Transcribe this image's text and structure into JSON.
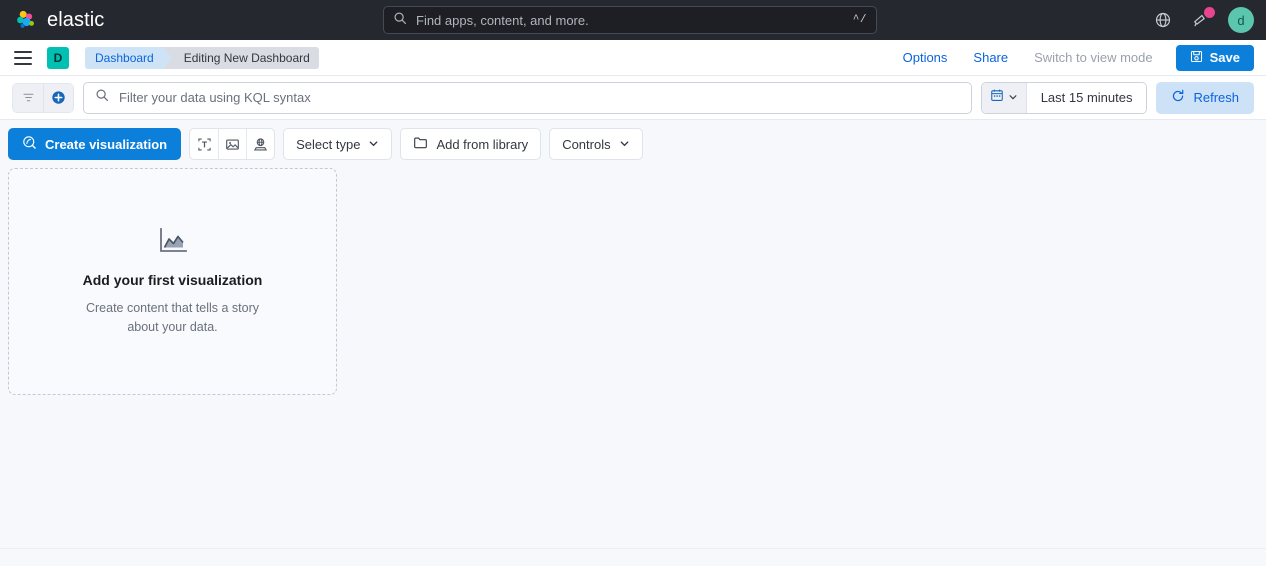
{
  "header": {
    "brand": "elastic",
    "logo_icon": "elastic-logo-icon",
    "search": {
      "placeholder": "Find apps, content, and more.",
      "icon": "search-icon",
      "shortcut": "^/"
    },
    "right_icons": [
      {
        "name": "globe-icon",
        "label": ""
      },
      {
        "name": "announcement-icon",
        "label": "",
        "badge": true
      }
    ],
    "avatar": {
      "initial": "d",
      "color": "#5bc6ad"
    }
  },
  "breadcrumb_bar": {
    "menu_icon": "hamburger-menu-icon",
    "space_badge": "D",
    "crumbs": [
      {
        "label": "Dashboard",
        "style": "blue"
      },
      {
        "label": "Editing New Dashboard",
        "style": "gray"
      }
    ],
    "options_label": "Options",
    "share_label": "Share",
    "view_mode_label": "Switch to view mode",
    "save_label": "Save",
    "save_icon": "save-floppy-icon"
  },
  "query_bar": {
    "filter_icon": "filter-funnel-icon",
    "add_filter_icon": "add-filter-plus-icon",
    "search_icon": "search-icon",
    "kql_placeholder": "Filter your data using KQL syntax",
    "calendar_icon": "calendar-icon",
    "chevron_icon": "chevron-down-icon",
    "date_range": "Last 15 minutes",
    "refresh_label": "Refresh",
    "refresh_icon": "refresh-icon"
  },
  "toolbar": {
    "create_visualization_label": "Create visualization",
    "create_visualization_icon": "lens-icon",
    "quick_buttons": [
      {
        "name": "add-text-icon"
      },
      {
        "name": "add-image-icon"
      },
      {
        "name": "add-map-icon"
      }
    ],
    "select_type_label": "Select type",
    "add_from_library_label": "Add from library",
    "add_from_library_icon": "folder-icon",
    "controls_label": "Controls"
  },
  "empty_state": {
    "icon": "area-chart-icon",
    "title": "Add your first visualization",
    "subtitle": "Create content that tells a story about your data."
  },
  "colors": {
    "primary": "#0b7fd9",
    "link": "#0b64dd",
    "accent_teal": "#00bfb3",
    "badge_pink": "#e7458e",
    "header_dark": "#25282f",
    "page_bg": "#f7f8fc"
  }
}
